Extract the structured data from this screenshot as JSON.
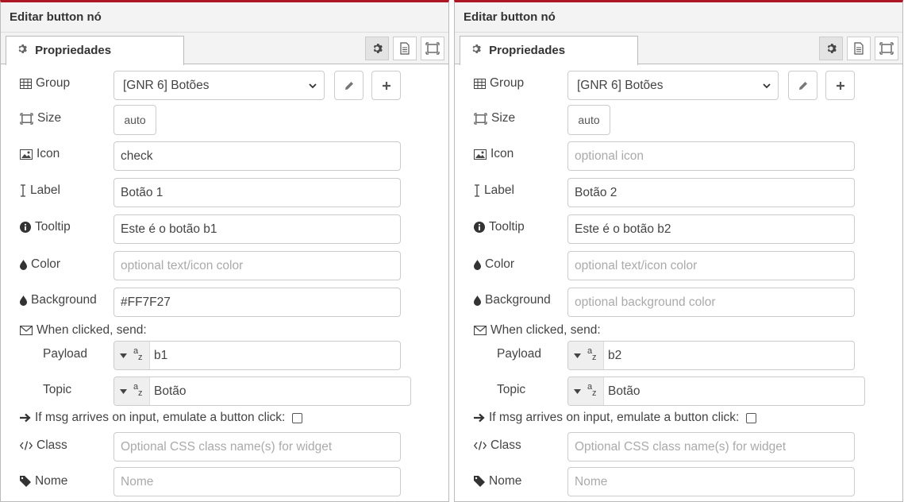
{
  "left": {
    "title": "Editar button nó",
    "tab": "Propriedades",
    "labels": {
      "group": "Group",
      "size": "Size",
      "icon": "Icon",
      "label": "Label",
      "tooltip": "Tooltip",
      "color": "Color",
      "background": "Background",
      "when_clicked": "When clicked, send:",
      "payload": "Payload",
      "topic": "Topic",
      "emulate": "If msg arrives on input, emulate a button click:",
      "class": "Class",
      "name": "Nome"
    },
    "group_value": "[GNR 6] Botões",
    "size_value": "auto",
    "icon_value": "check",
    "icon_placeholder": "optional icon",
    "label_value": "Botão 1",
    "tooltip_value": "Este é o botão b1",
    "color_placeholder": "optional text/icon color",
    "background_value": "#FF7F27",
    "background_placeholder": "optional background color",
    "payload_value": "b1",
    "topic_value": "Botão",
    "class_placeholder": "Optional CSS class name(s) for widget",
    "name_placeholder": "Nome"
  },
  "right": {
    "title": "Editar button nó",
    "tab": "Propriedades",
    "labels": {
      "group": "Group",
      "size": "Size",
      "icon": "Icon",
      "label": "Label",
      "tooltip": "Tooltip",
      "color": "Color",
      "background": "Background",
      "when_clicked": "When clicked, send:",
      "payload": "Payload",
      "topic": "Topic",
      "emulate": "If msg arrives on input, emulate a button click:",
      "class": "Class",
      "name": "Nome"
    },
    "group_value": "[GNR 6] Botões",
    "size_value": "auto",
    "icon_value": "",
    "icon_placeholder": "optional icon",
    "label_value": "Botão 2",
    "tooltip_value": "Este é o botão b2",
    "color_placeholder": "optional text/icon color",
    "background_value": "",
    "background_placeholder": "optional background color",
    "payload_value": "b2",
    "topic_value": "Botão",
    "class_placeholder": "Optional CSS class name(s) for widget",
    "name_placeholder": "Nome"
  },
  "colors": {
    "header_accent": "#ad1625"
  }
}
